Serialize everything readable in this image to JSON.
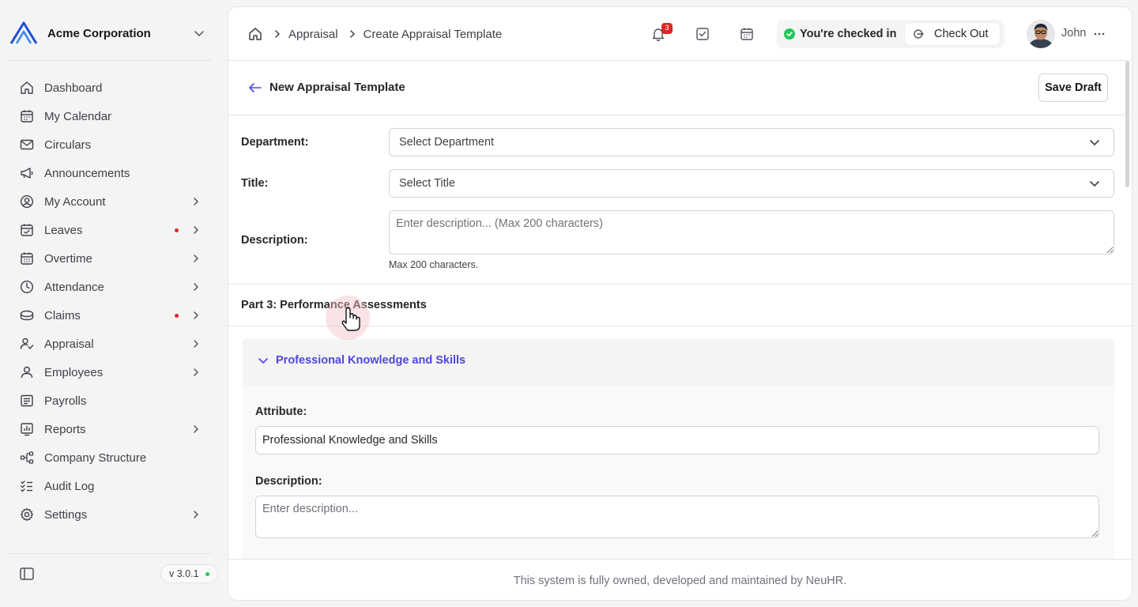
{
  "colors": {
    "accent": "#4f46e5",
    "danger": "#dc2626",
    "success": "#22c55e",
    "brand": "#1d4ed8"
  },
  "sidebar": {
    "org_name": "Acme Corporation",
    "items": [
      {
        "label": "Dashboard",
        "icon": "home-icon",
        "chevron": false,
        "dot": false
      },
      {
        "label": "My Calendar",
        "icon": "calendar-icon",
        "chevron": false,
        "dot": false
      },
      {
        "label": "Circulars",
        "icon": "mail-icon",
        "chevron": false,
        "dot": false
      },
      {
        "label": "Announcements",
        "icon": "megaphone-icon",
        "chevron": false,
        "dot": false
      },
      {
        "label": "My Account",
        "icon": "user-circle-icon",
        "chevron": true,
        "dot": false
      },
      {
        "label": "Leaves",
        "icon": "calendar-check-icon",
        "chevron": true,
        "dot": true
      },
      {
        "label": "Overtime",
        "icon": "calendar-grid-icon",
        "chevron": true,
        "dot": false
      },
      {
        "label": "Attendance",
        "icon": "clock-icon",
        "chevron": true,
        "dot": false
      },
      {
        "label": "Claims",
        "icon": "coins-icon",
        "chevron": true,
        "dot": true
      },
      {
        "label": "Appraisal",
        "icon": "user-check-icon",
        "chevron": true,
        "dot": false
      },
      {
        "label": "Employees",
        "icon": "user-icon",
        "chevron": true,
        "dot": false
      },
      {
        "label": "Payrolls",
        "icon": "receipt-icon",
        "chevron": false,
        "dot": false
      },
      {
        "label": "Reports",
        "icon": "chart-icon",
        "chevron": true,
        "dot": false
      },
      {
        "label": "Company Structure",
        "icon": "hierarchy-icon",
        "chevron": false,
        "dot": false
      },
      {
        "label": "Audit Log",
        "icon": "checklist-icon",
        "chevron": false,
        "dot": false
      },
      {
        "label": "Settings",
        "icon": "gear-icon",
        "chevron": true,
        "dot": false
      }
    ],
    "version": "v 3.0.1"
  },
  "header": {
    "breadcrumbs": [
      "Appraisal",
      "Create Appraisal Template"
    ],
    "notification_count": "3",
    "checkin_status": "You're checked in",
    "checkout_label": "Check Out",
    "user_name": "John"
  },
  "page": {
    "title": "New Appraisal Template",
    "save_draft_label": "Save Draft",
    "department_label": "Department:",
    "department_value": "Select Department",
    "title_label": "Title:",
    "title_value": "Select Title",
    "description_label": "Description:",
    "description_placeholder": "Enter description... (Max 200 characters)",
    "description_hint": "Max 200 characters.",
    "section_title": "Part 3: Performance Assessments",
    "accordion": {
      "title": "Professional Knowledge and Skills",
      "attribute_label": "Attribute:",
      "attribute_value": "Professional Knowledge and Skills",
      "description_label": "Description:",
      "description_placeholder": "Enter description..."
    }
  },
  "footer": {
    "text": "This system is fully owned, developed and maintained by NeuHR."
  }
}
